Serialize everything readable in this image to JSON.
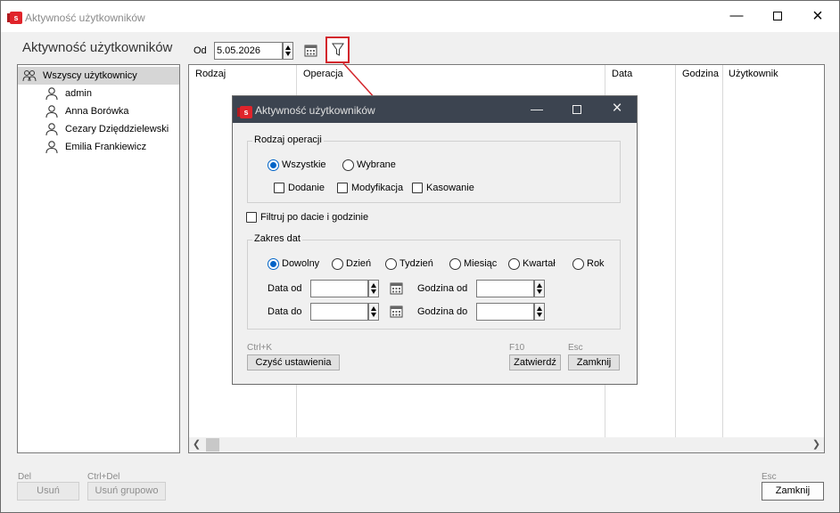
{
  "main_window": {
    "title": "Aktywność użytkowników",
    "app_icon_letter": "s",
    "section_title": "Aktywność użytkowników"
  },
  "users": {
    "all_label": "Wszyscy użytkownicy",
    "items": [
      "admin",
      "Anna Borówka",
      "Cezary Dzięddzielewski",
      "Emilia Frankiewicz"
    ]
  },
  "date_filter": {
    "label": "Od",
    "value": "5.05.2026"
  },
  "grid": {
    "columns": [
      "Rodzaj",
      "Operacja",
      "Data",
      "Godzina",
      "Użytkownik"
    ]
  },
  "footer": {
    "delete_shortcut": "Del",
    "delete_label": "Usuń",
    "group_delete_shortcut": "Ctrl+Del",
    "group_delete_label": "Usuń grupowo",
    "close_shortcut": "Esc",
    "close_label": "Zamknij"
  },
  "dialog": {
    "title": "Aktywność użytkowników",
    "operation_group_title": "Rodzaj operacji",
    "op_all": "Wszystkie",
    "op_selected": "Wybrane",
    "op_selected_value": "all",
    "op_add": "Dodanie",
    "op_modify": "Modyfikacja",
    "op_delete": "Kasowanie",
    "filter_by_date": "Filtruj po dacie i godzinie",
    "date_range_group_title": "Zakres dat",
    "range_options": [
      "Dowolny",
      "Dzień",
      "Tydzień",
      "Miesiąc",
      "Kwartał",
      "Rok"
    ],
    "range_selected": "Dowolny",
    "date_from_label": "Data od",
    "date_to_label": "Data do",
    "time_from_label": "Godzina od",
    "time_to_label": "Godzina do",
    "date_from_value": "",
    "date_to_value": "",
    "time_from_value": "",
    "time_to_value": "",
    "clear_shortcut": "Ctrl+K",
    "clear_label": "Czyść ustawienia",
    "confirm_shortcut": "F10",
    "confirm_label": "Zatwierdź",
    "close_shortcut": "Esc",
    "close_label": "Zamknij"
  },
  "colors": {
    "accent_red": "#d3262c",
    "dialog_titlebar": "#3c4450",
    "radio_blue": "#0063c7"
  }
}
